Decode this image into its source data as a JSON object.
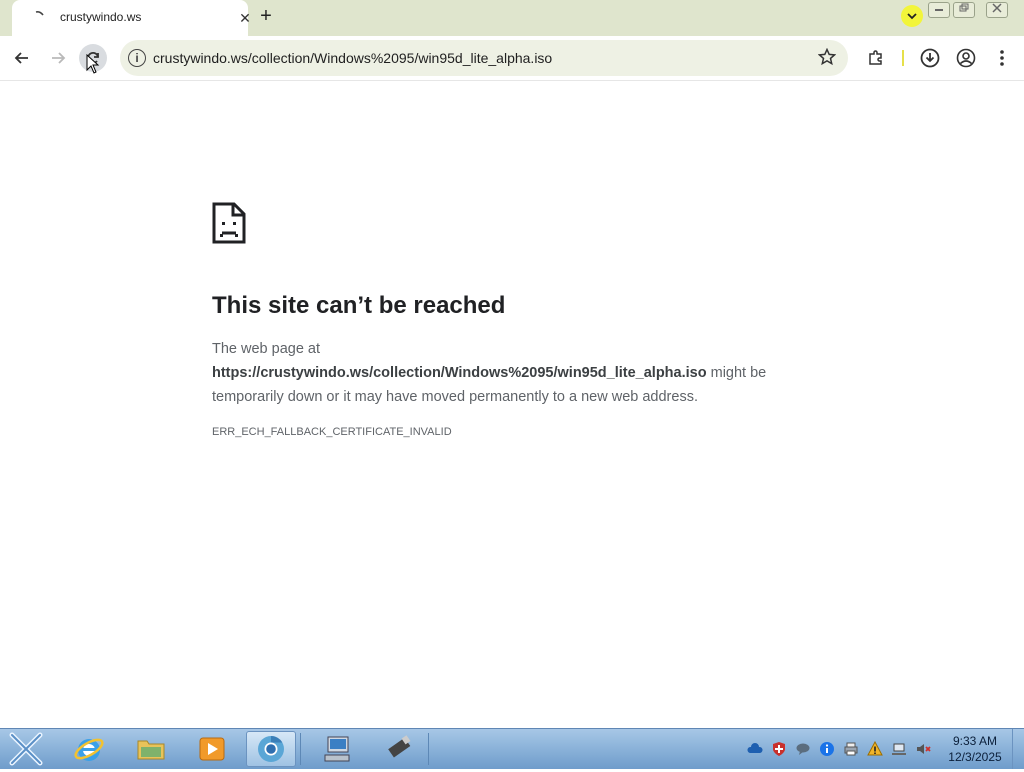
{
  "browser": {
    "tab": {
      "title": "crustywindo.ws"
    },
    "newtab_symbol": "+",
    "close_symbol": "✕",
    "omnibox": {
      "url": "crustywindo.ws/collection/Windows%2095/win95d_lite_alpha.iso"
    }
  },
  "error_page": {
    "heading": "This site can’t be reached",
    "body_prefix": "The web page at",
    "url": "https://crustywindo.ws/collection/Windows%2095/win95d_lite_alpha.iso",
    "body_suffix": " might be temporarily down or it may have moved permanently to a new web address.",
    "code": "ERR_ECH_FALLBACK_CERTIFICATE_INVALID"
  },
  "taskbar": {
    "clock": {
      "time": "9:33 AM",
      "date": "12/3/2025"
    },
    "apps": [
      "internet-explorer",
      "file-explorer",
      "media-player",
      "chrome",
      "network-computer",
      "usb-drive"
    ]
  },
  "colors": {
    "tabstrip": "#dfe5cd",
    "omnibox": "#eef1e4",
    "taskbar": "#8db4da",
    "tabsearch": "#f2f53a"
  }
}
